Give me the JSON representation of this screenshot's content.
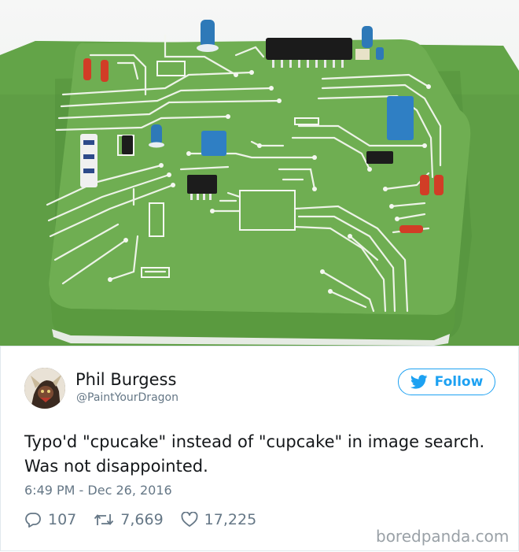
{
  "tweet": {
    "author_name": "Phil Burgess",
    "author_handle": "@PaintYourDragon",
    "follow_label": "Follow",
    "text": "Typo'd \"cpucake\" instead of \"cupcake\" in image search. Was not disappointed.",
    "timestamp": "6:49 PM - Dec 26, 2016",
    "replies": "107",
    "retweets": "7,669",
    "likes": "17,225"
  },
  "watermark": "boredpanda.com",
  "icons": {
    "follow": "twitter-bird-icon",
    "reply": "reply-icon",
    "retweet": "retweet-icon",
    "like": "heart-icon"
  },
  "colors": {
    "accent": "#1da1f2",
    "cake_green": "#6aa84f",
    "secondary_text": "#657786"
  }
}
